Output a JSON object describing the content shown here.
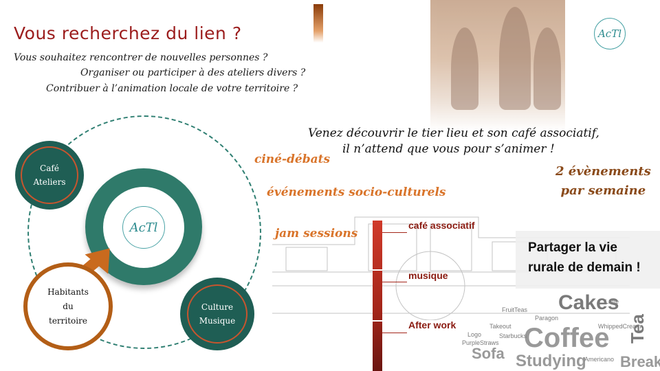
{
  "header": {
    "title": "Vous recherchez du lien ?",
    "questions": [
      "Vous souhaitez rencontrer de nouvelles personnes ?",
      "Organiser ou participer à des ateliers divers ?",
      "Contribuer à l’animation locale de votre territoire ?"
    ]
  },
  "logo": {
    "text": "AcTl"
  },
  "invite": {
    "line1": "Venez découvrir le tier lieu et son café associatif,",
    "line2": "il n’attend que vous pour s’animer !"
  },
  "activities": [
    "ciné-débats",
    "événements socio-culturels",
    "jam sessions"
  ],
  "events": {
    "line1": "2 évènements",
    "line2": "par semaine"
  },
  "diagram": {
    "cafe": [
      "Café",
      "Ateliers"
    ],
    "habitants": [
      "Habitants",
      "du",
      "territoire"
    ],
    "culture": [
      "Culture",
      "Musique"
    ]
  },
  "timeline": [
    "café associatif",
    "musique",
    "After work"
  ],
  "share": {
    "line1": "Partager la vie",
    "line2": "rurale de demain !"
  },
  "wordcloud": [
    "Cakes",
    "Coffee",
    "Tea",
    "Sofa",
    "Studying",
    "Breakfast",
    "FruitTeas",
    "Latte",
    "WhippedCream",
    "Americano",
    "Logo",
    "PurpleStraws",
    "Paragon",
    "Takeout",
    "Starbucks"
  ],
  "colors": {
    "teal": "#2f7a6a",
    "dark_teal": "#1f5e54",
    "orange": "#d9742a",
    "brown": "#b35e16",
    "red": "#a32519",
    "title": "#9b1c1c"
  }
}
